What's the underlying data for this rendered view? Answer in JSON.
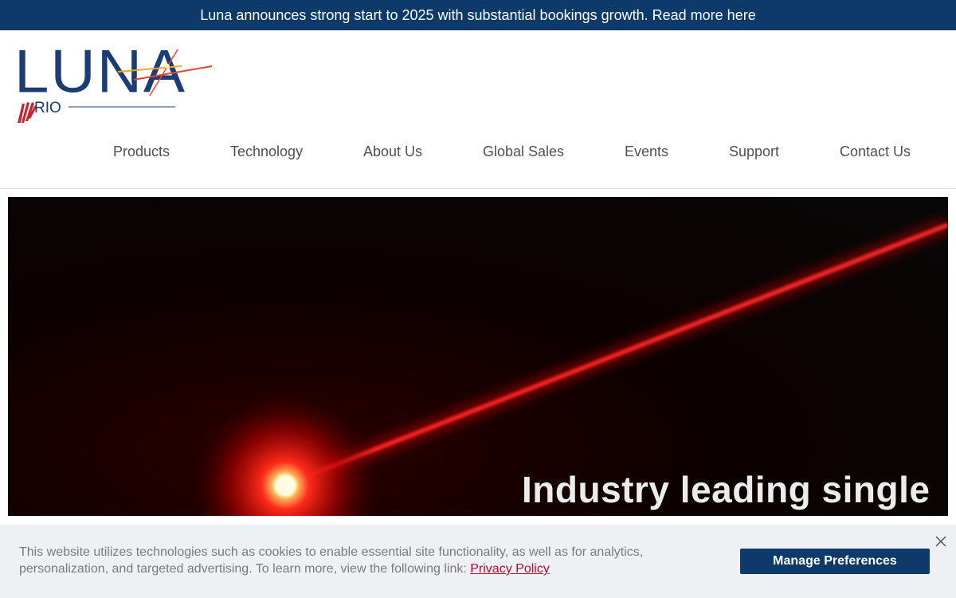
{
  "announcement": {
    "text": "Luna announces strong start to 2025 with substantial bookings growth. Read more here"
  },
  "logo": {
    "brand": "LUNA",
    "sub_brand": "RIO"
  },
  "nav": {
    "items": [
      {
        "label": "Products"
      },
      {
        "label": "Technology"
      },
      {
        "label": "About Us"
      },
      {
        "label": "Global Sales"
      },
      {
        "label": "Events"
      },
      {
        "label": "Support"
      },
      {
        "label": "Contact Us"
      }
    ]
  },
  "hero": {
    "caption": "Industry leading single"
  },
  "cookie_banner": {
    "text": "This website utilizes technologies such as cookies to enable essential site functionality, as well as for analytics, personalization, and targeted advertising. To learn more, view the following link:",
    "link_label": "Privacy Policy",
    "button_label": "Manage Preferences",
    "close_icon": "close-icon"
  },
  "colors": {
    "brand_navy": "#0e3a6b",
    "logo_blue": "#1b3c74",
    "laser_red": "#ff1a1a",
    "link_red": "#b0102a",
    "banner_bg": "#eef0f4"
  }
}
